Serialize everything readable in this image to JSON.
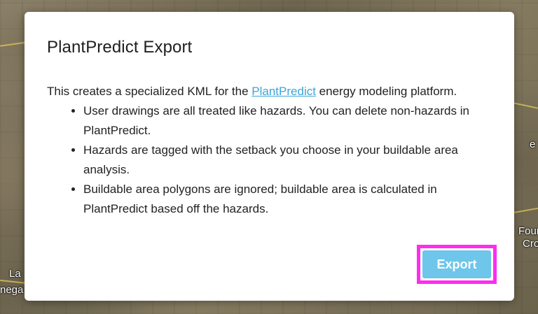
{
  "map": {
    "labels": {
      "four": "Four",
      "cro": "Cro",
      "la": "La",
      "nega": "nega",
      "e": "e"
    }
  },
  "modal": {
    "title": "PlantPredict Export",
    "intro_before_link": "This creates a specialized KML for the ",
    "link_text": "PlantPredict",
    "intro_after_link": " energy modeling platform.",
    "bullets": [
      "User drawings are all treated like hazards. You can delete non-hazards in PlantPredict.",
      "Hazards are tagged with the setback you choose in your buildable area analysis.",
      "Buildable area polygons are ignored; buildable area is calculated in PlantPredict based off the hazards."
    ],
    "export_label": "Export"
  },
  "colors": {
    "link": "#3aa5d6",
    "button_bg": "#6ec6ea",
    "highlight": "#ff2cf0"
  }
}
